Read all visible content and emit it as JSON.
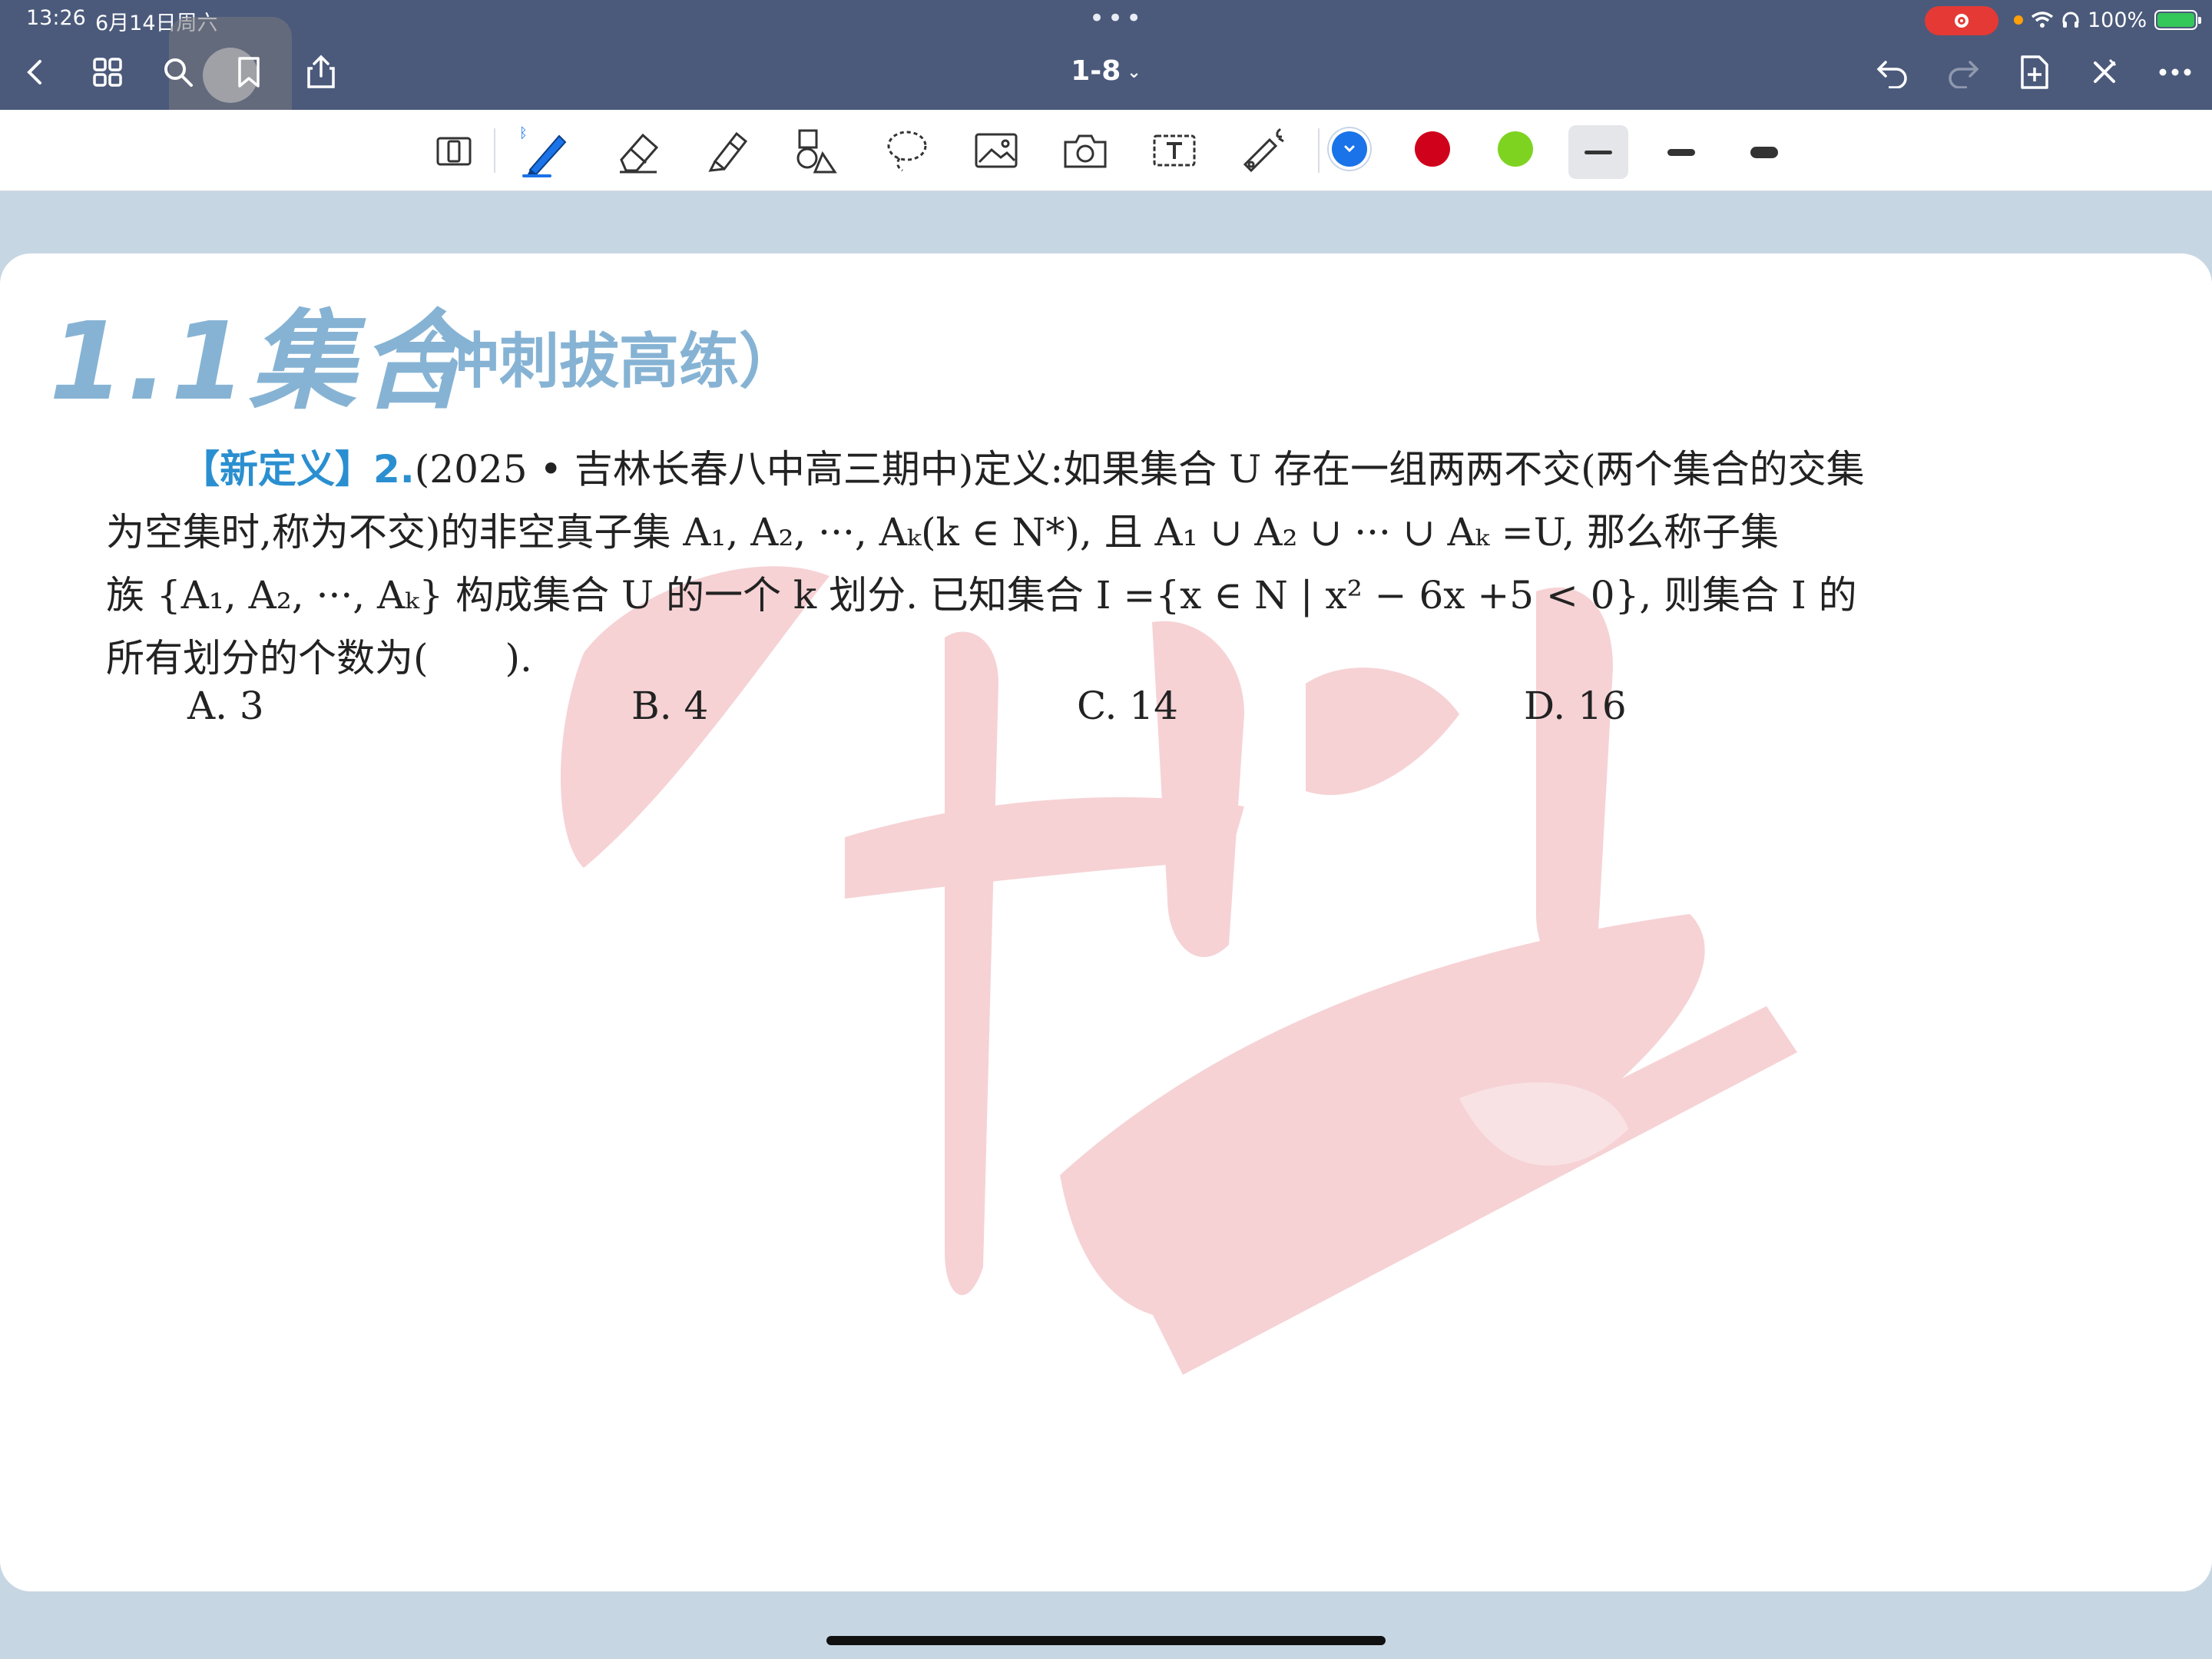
{
  "status": {
    "time": "13:26",
    "date": "6月14日周六",
    "battery": "100%"
  },
  "nav": {
    "title": "1-8",
    "icons": [
      "back-icon",
      "grid-icon",
      "search-icon",
      "bookmark-icon",
      "share-icon",
      "undo-icon",
      "redo-icon",
      "add-page-icon",
      "close-icon",
      "more-icon"
    ]
  },
  "toolbar": {
    "tools": [
      "page-scroll-icon",
      "pen-icon",
      "eraser-icon",
      "highlighter-icon",
      "shapes-icon",
      "lasso-icon",
      "image-icon",
      "camera-icon",
      "text-box-icon",
      "laser-pointer-icon"
    ],
    "colors": [
      "#1a73e8",
      "#d0021b",
      "#7ed321"
    ],
    "selected_color": "#1a73e8",
    "selected_stroke": 0
  },
  "page": {
    "title": "1.1集合",
    "subtitle": "（冲刺拔高练）",
    "question": {
      "tag": "【新定义】",
      "number": "2.",
      "line1": "(2025 • 吉林长春八中高三期中)定义:如果集合 U 存在一组两两不交(两个集合的交集",
      "line2": "为空集时,称为不交)的非空真子集 A₁, A₂, ···, Aₖ(k ∈ N*), 且 A₁ ∪ A₂ ∪ ··· ∪ Aₖ =U, 那么称子集",
      "line3": "族 {A₁, A₂, ···, Aₖ} 构成集合 U 的一个 k 划分. 已知集合 I ={x ∈ N | x² − 6x +5 < 0}, 则集合 I 的",
      "line4": "所有划分的个数为(　　)."
    },
    "options": {
      "a": "A.  3",
      "b": "B.  4",
      "c": "C.  14",
      "d": "D.  16"
    }
  }
}
